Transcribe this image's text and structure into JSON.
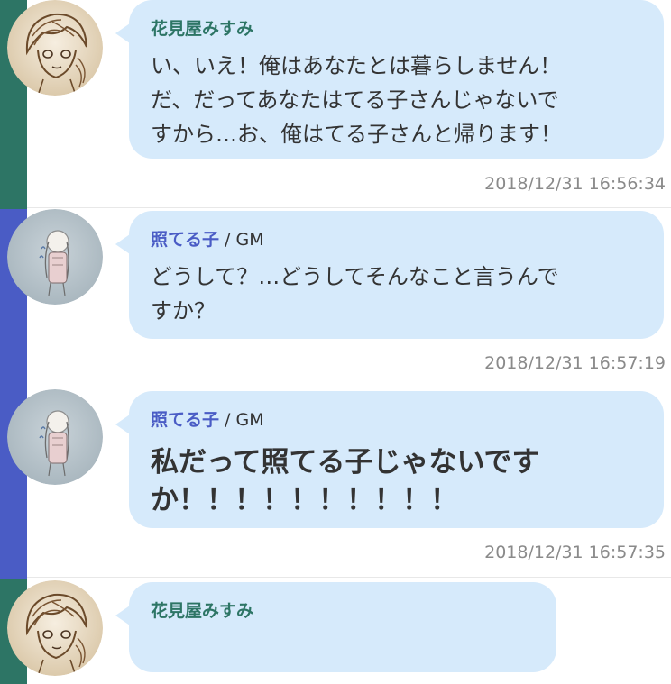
{
  "colors": {
    "strip_misumi": "#2d7565",
    "strip_teruko": "#4a5cc5",
    "name_misumi": "#2d7565",
    "name_teruko": "#4a5cc5",
    "bubble": "#d6eafb",
    "timestamp": "#8a8a8a"
  },
  "messages": [
    {
      "sender": "花見屋みすみ",
      "role": "",
      "text": "い、いえ！俺はあなたとは暮らしません！\nだ、だってあなたはてる子さんじゃないで\nすから…お、俺はてる子さんと帰ります！",
      "timestamp": "2018/12/31  16:56:34",
      "avatar": "sketch-boy-avatar"
    },
    {
      "sender": "照てる子",
      "role": " / GM",
      "text": "どうして？…どうしてそんなこと言うんで\nすか？",
      "timestamp": "2018/12/31  16:57:19",
      "avatar": "sketch-girl-avatar"
    },
    {
      "sender": "照てる子",
      "role": " / GM",
      "text": "私だって照てる子じゃないです\nか！！！！！！！！！！",
      "timestamp": "2018/12/31  16:57:35",
      "avatar": "sketch-girl-avatar"
    },
    {
      "sender": "花見屋みすみ",
      "role": "",
      "text": "",
      "timestamp": "",
      "avatar": "sketch-boy-avatar"
    }
  ]
}
